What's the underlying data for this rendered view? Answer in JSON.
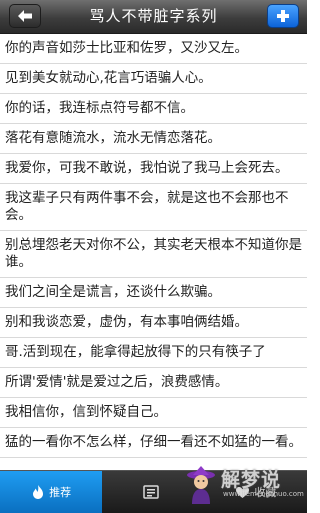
{
  "header": {
    "title": "骂人不带脏字系列",
    "back_icon": "arrow-left-icon",
    "add_icon": "plus-icon"
  },
  "items": [
    "你的声音如莎士比亚和佐罗，又沙又左。",
    "见到美女就动心,花言巧语骗人心。",
    "你的话，我连标点符号都不信。",
    "落花有意随流水，流水无情恋落花。",
    "我爱你，可我不敢说，我怕说了我马上会死去。",
    "我这辈子只有两件事不会，就是这也不会那也不会。",
    "别总埋怨老天对你不公，其实老天根本不知道你是谁。",
    "我们之间全是谎言，还谈什么欺骗。",
    "别和我谈恋爱，虚伪，有本事咱俩结婚。",
    "哥.活到现在，能拿得起放得下的只有筷子了",
    "所谓'爱情'就是爱过之后，浪费感情。",
    "我相信你，信到怀疑自己。",
    "猛的一看你不怎么样，仔细一看还不如猛的一看。"
  ],
  "tabs": [
    {
      "label": "推荐",
      "icon": "flame-icon",
      "active": true
    },
    {
      "label": "",
      "icon": "list-icon",
      "active": false
    },
    {
      "label": "收藏",
      "icon": "heart-icon",
      "active": false
    }
  ],
  "watermark": {
    "text": "解梦说",
    "sub": "www.jiemengshuo.com"
  },
  "colors": {
    "header_dark": "#2a2a2a",
    "accent_blue": "#1f9df2",
    "divider": "#d9d9d9",
    "text": "#222222"
  }
}
